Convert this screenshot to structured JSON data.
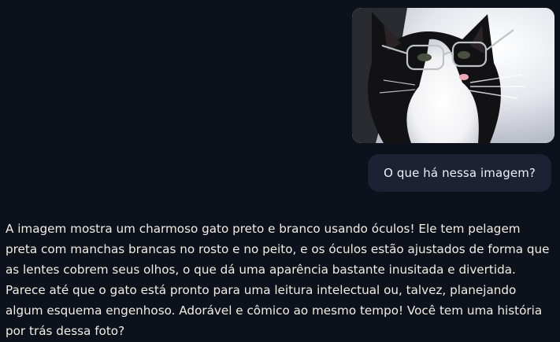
{
  "chat": {
    "messages": [
      {
        "role": "user",
        "type": "image"
      },
      {
        "role": "user",
        "type": "text",
        "text": "O que há nessa imagem?"
      },
      {
        "role": "assistant",
        "type": "text",
        "text": "A imagem mostra um charmoso gato preto e branco usando óculos! Ele tem pelagem preta com manchas brancas no rosto e no peito, e os óculos estão ajustados de forma que as lentes cobrem seus olhos, o que dá uma aparência bastante inusitada e divertida. Parece até que o gato está pronto para uma leitura intelectual ou, talvez, planejando algum esquema engenhoso. Adorável e cômico ao mesmo tempo! Você tem uma história por trás dessa foto?"
      }
    ]
  },
  "colors": {
    "background": "#0d111c",
    "user_bubble": "#1c2233",
    "text": "#f1ede3"
  }
}
